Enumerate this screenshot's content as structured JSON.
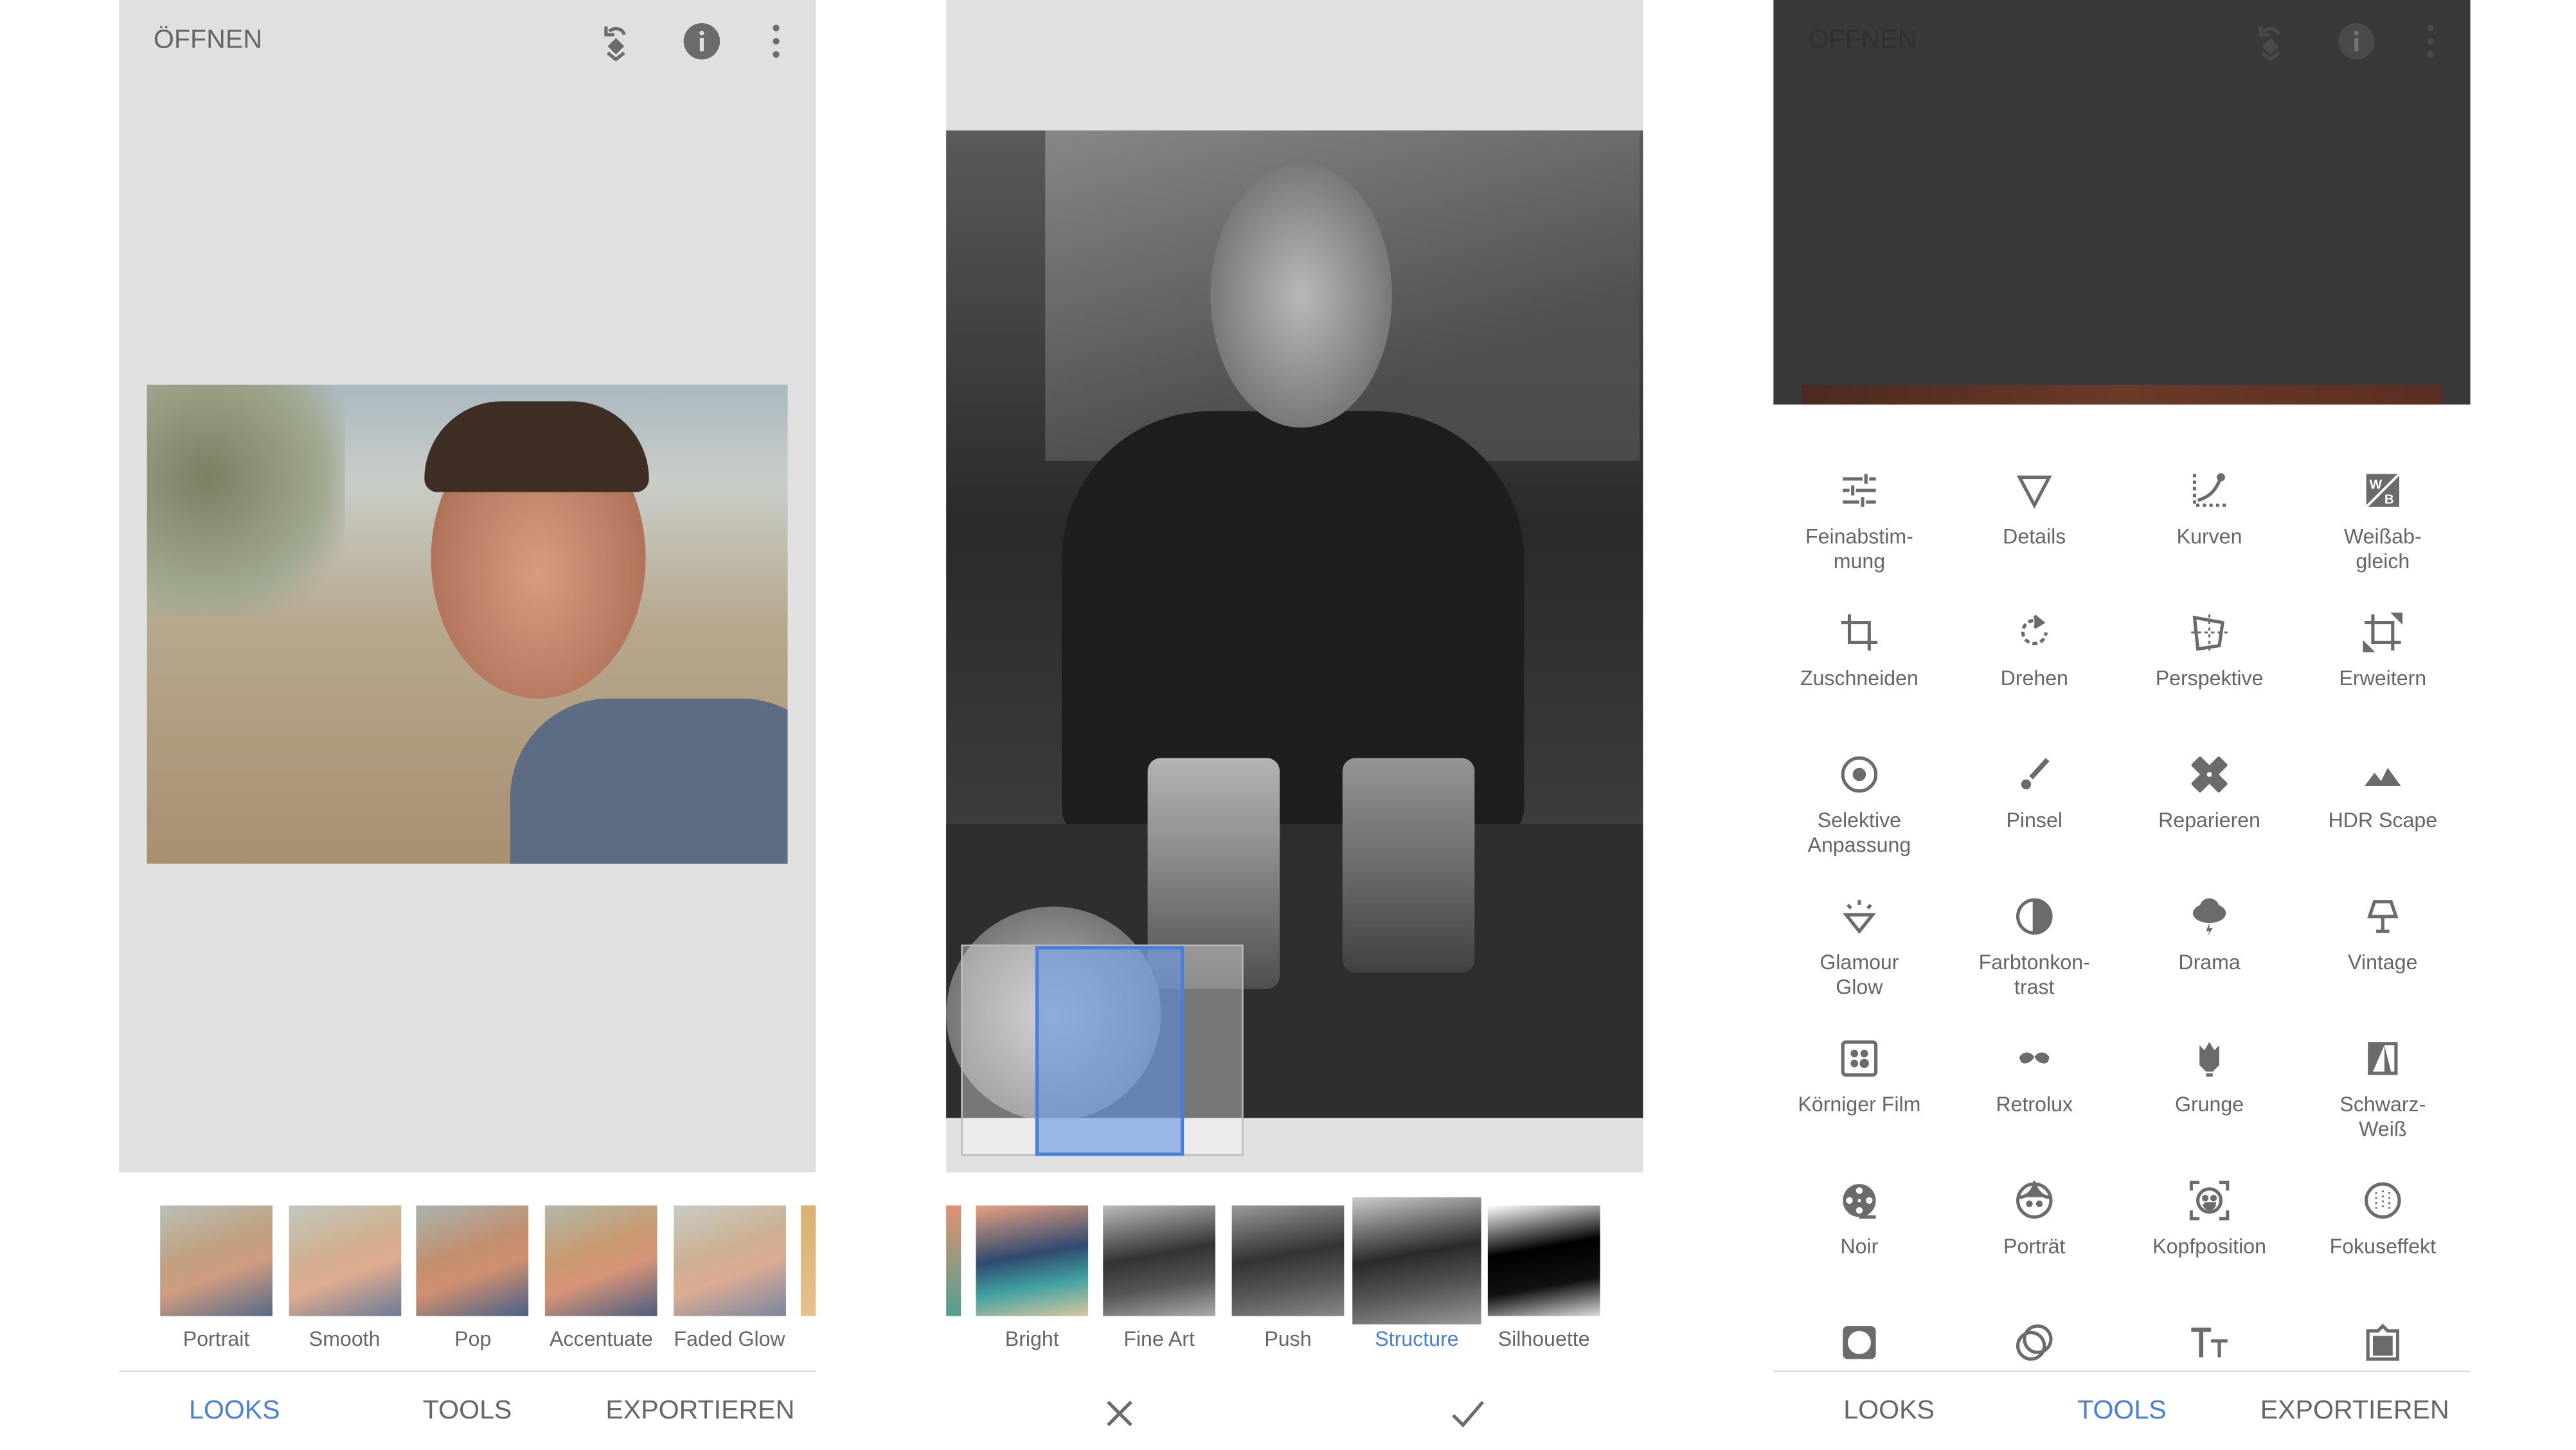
{
  "colors": {
    "accent": "#4a7fd9",
    "text": "#666666",
    "canvas": "#e0e0e0",
    "icon": "#6b6b6b"
  },
  "header": {
    "open_label": "ÖFFNEN",
    "icons": [
      "undo-layers-icon",
      "info-icon",
      "more-vert-icon"
    ]
  },
  "panel1": {
    "looks": [
      {
        "label": "Portrait"
      },
      {
        "label": "Smooth"
      },
      {
        "label": "Pop"
      },
      {
        "label": "Accentuate"
      },
      {
        "label": "Faded Glow"
      }
    ]
  },
  "panel2": {
    "filters": [
      {
        "label": "Bright"
      },
      {
        "label": "Fine Art"
      },
      {
        "label": "Push"
      },
      {
        "label": "Structure",
        "selected": true
      },
      {
        "label": "Silhouette"
      }
    ],
    "cancel_icon": "close-icon",
    "apply_icon": "check-icon"
  },
  "panel3": {
    "tools": [
      {
        "label": "Feinabstim-\nmung",
        "icon": "tune-icon"
      },
      {
        "label": "Details",
        "icon": "details-triangle-icon"
      },
      {
        "label": "Kurven",
        "icon": "curves-icon"
      },
      {
        "label": "Weißab-\ngleich",
        "icon": "white-balance-icon"
      },
      {
        "label": "Zuschneiden",
        "icon": "crop-icon"
      },
      {
        "label": "Drehen",
        "icon": "rotate-icon"
      },
      {
        "label": "Perspektive",
        "icon": "perspective-icon"
      },
      {
        "label": "Erweitern",
        "icon": "expand-icon"
      },
      {
        "label": "Selektive\nAnpassung",
        "icon": "selective-icon"
      },
      {
        "label": "Pinsel",
        "icon": "brush-icon"
      },
      {
        "label": "Reparieren",
        "icon": "healing-icon"
      },
      {
        "label": "HDR Scape",
        "icon": "mountain-icon"
      },
      {
        "label": "Glamour\nGlow",
        "icon": "diamond-icon"
      },
      {
        "label": "Farbtonkon-\ntrast",
        "icon": "tonal-contrast-icon"
      },
      {
        "label": "Drama",
        "icon": "storm-cloud-icon"
      },
      {
        "label": "Vintage",
        "icon": "lamp-icon"
      },
      {
        "label": "Körniger Film",
        "icon": "grain-icon"
      },
      {
        "label": "Retrolux",
        "icon": "mustache-icon"
      },
      {
        "label": "Grunge",
        "icon": "guitar-icon"
      },
      {
        "label": "Schwarz-\nWeiß",
        "icon": "bw-icon"
      },
      {
        "label": "Noir",
        "icon": "film-reel-icon"
      },
      {
        "label": "Porträt",
        "icon": "face-icon"
      },
      {
        "label": "Kopfposition",
        "icon": "head-pose-icon"
      },
      {
        "label": "Fokuseffekt",
        "icon": "lens-blur-icon"
      },
      {
        "label": "",
        "icon": "vignette-icon"
      },
      {
        "label": "",
        "icon": "double-exposure-icon"
      },
      {
        "label": "",
        "icon": "text-icon"
      },
      {
        "label": "",
        "icon": "frames-icon"
      }
    ]
  },
  "tabs": {
    "looks": "LOOKS",
    "tools": "TOOLS",
    "export": "EXPORTIEREN"
  }
}
